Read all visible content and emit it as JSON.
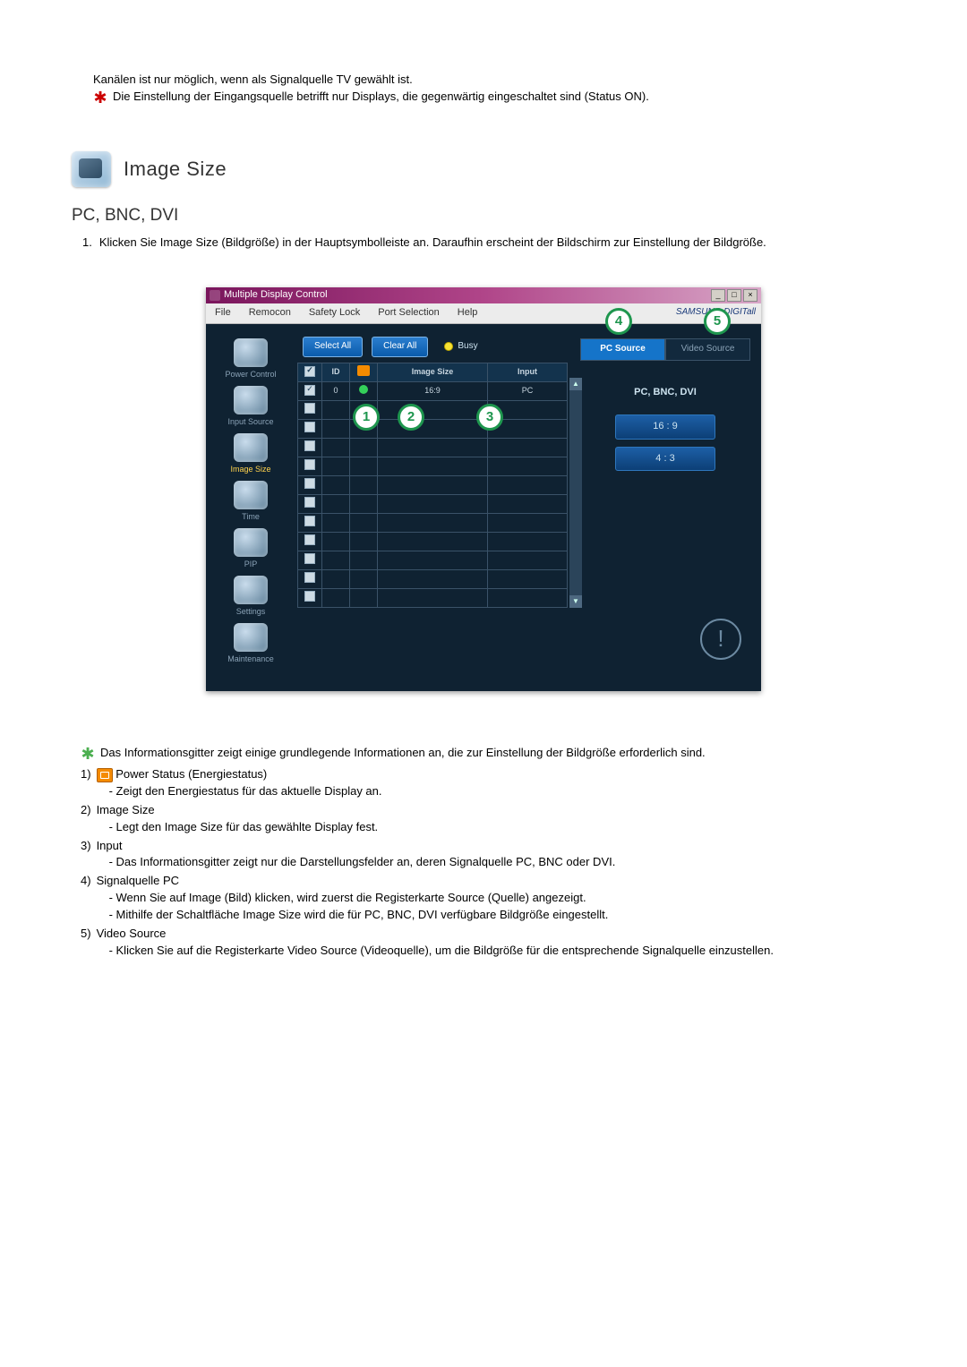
{
  "intro": {
    "line1": "Kanälen ist nur möglich, wenn als Signalquelle TV gewählt ist.",
    "line2": "Die Einstellung der Eingangsquelle betrifft nur Displays, die gegenwärtig eingeschaltet sind (Status ON)."
  },
  "section": {
    "title": "Image Size",
    "subtitle": "PC, BNC, DVI",
    "step": "Klicken Sie Image Size (Bildgröße) in der Hauptsymbolleiste an. Daraufhin erscheint der Bildschirm zur Einstellung der Bildgröße."
  },
  "window": {
    "title": "Multiple Display Control",
    "menu": {
      "file": "File",
      "remocon": "Remocon",
      "safety": "Safety Lock",
      "port": "Port Selection",
      "help": "Help"
    },
    "brand": "SAMSUNG DIGITall",
    "toolbar": {
      "select_all": "Select All",
      "clear_all": "Clear All",
      "busy": "Busy"
    },
    "sidebar": {
      "power": "Power Control",
      "input": "Input Source",
      "image": "Image Size",
      "time": "Time",
      "pip": "PIP",
      "settings": "Settings",
      "maintenance": "Maintenance"
    },
    "grid": {
      "hdr_id": "ID",
      "hdr_image": "Image Size",
      "hdr_input": "Input",
      "row_id": "0",
      "row_image": "16:9",
      "row_input": "PC"
    },
    "tabs": {
      "pc": "PC Source",
      "video": "Video Source"
    },
    "panel": {
      "head": "PC, BNC, DVI",
      "opt1": "16 : 9",
      "opt2": "4 : 3"
    },
    "callouts": {
      "c1": "1",
      "c2": "2",
      "c3": "3",
      "c4": "4",
      "c5": "5"
    }
  },
  "legend": {
    "intro": "Das Informationsgitter zeigt einige grundlegende Informationen an, die zur Einstellung der Bildgröße erforderlich sind.",
    "i1_title": "Power Status (Energiestatus)",
    "i1_sub": "- Zeigt den Energiestatus für das aktuelle Display an.",
    "i2_title": "Image Size",
    "i2_sub": "- Legt den Image Size für das gewählte Display fest.",
    "i3_title": "Input",
    "i3_sub": "- Das Informationsgitter zeigt nur die Darstellungsfelder an, deren Signalquelle PC, BNC oder DVI.",
    "i4_title": "Signalquelle PC",
    "i4_sub1": "- Wenn Sie auf Image (Bild) klicken, wird zuerst die Registerkarte Source (Quelle) angezeigt.",
    "i4_sub2": "- Mithilfe der Schaltfläche Image Size wird die für PC, BNC, DVI verfügbare Bildgröße eingestellt.",
    "i5_title": "Video Source",
    "i5_sub": "- Klicken Sie auf die Registerkarte Video Source (Videoquelle), um die Bildgröße für die entsprechende Signalquelle einzustellen."
  }
}
